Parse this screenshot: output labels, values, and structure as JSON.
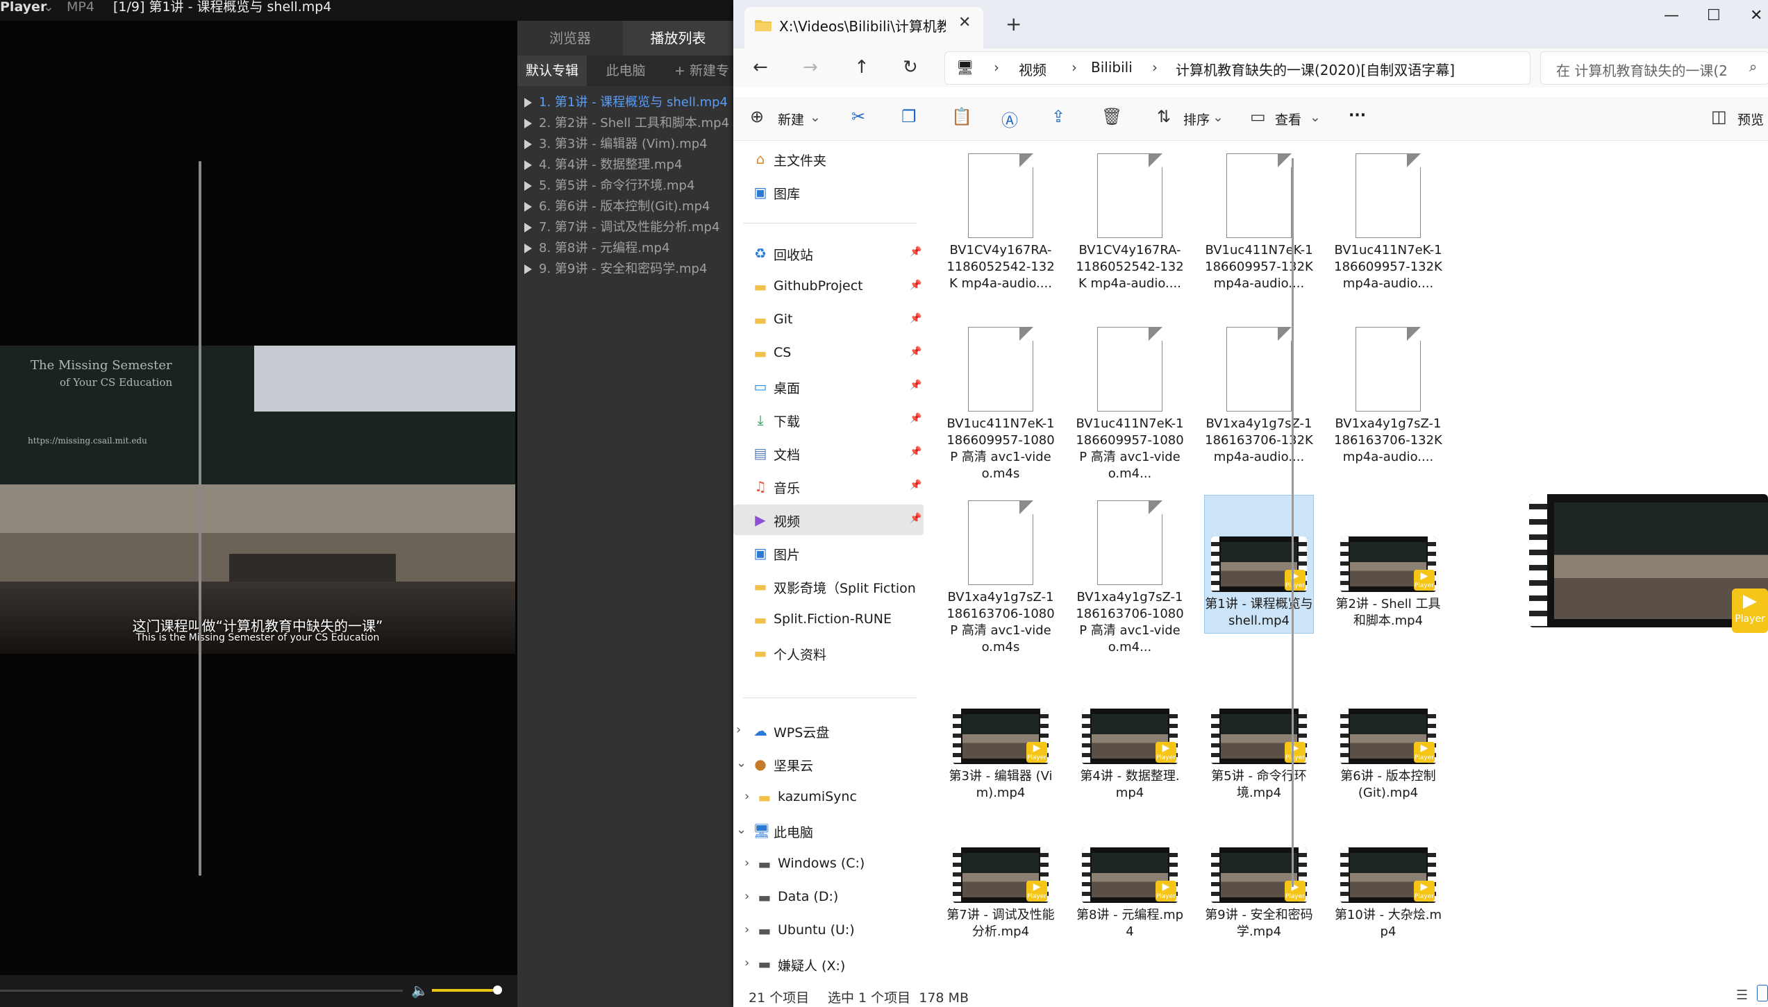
{
  "player": {
    "app_name": "Player",
    "format": "MP4",
    "title": "[1/9] 第1讲 - 课程概览与 shell.mp4",
    "tabs": [
      "浏览器",
      "播放列表"
    ],
    "subtabs": [
      "默认专辑",
      "此电脑",
      "+ 新建专"
    ],
    "playlist": [
      "1. 第1讲 - 课程概览与 shell.mp4",
      "2. 第2讲 - Shell 工具和脚本.mp4",
      "3. 第3讲 - 编辑器 (Vim).mp4",
      "4. 第4讲 - 数据整理.mp4",
      "5. 第5讲 - 命令行环境.mp4",
      "6. 第6讲 - 版本控制(Git).mp4",
      "7. 第7讲 - 调试及性能分析.mp4",
      "8. 第8讲 - 元编程.mp4",
      "9. 第9讲 - 安全和密码学.mp4"
    ],
    "active_index": 0,
    "video": {
      "board_text": "The Missing Semester",
      "board_text2": "of Your CS Education",
      "board_url": "https://missing.csail.mit.edu",
      "subtitle_cn": "这门课程叫做“计算机教育中缺失的一课”",
      "subtitle_en": "This is the Missing Semester of your CS Education"
    },
    "volume_fraction": 0.92,
    "accent": "#5b9cf5"
  },
  "explorer": {
    "tab_title": "X:\\Videos\\Bilibili\\计算机教育缺",
    "window_buttons": [
      "—",
      "☐",
      "✕"
    ],
    "breadcrumb": [
      "视频",
      "Bilibili",
      "计算机教育缺失的一课(2020)[自制双语字幕]"
    ],
    "search_placeholder": "在 计算机教育缺失的一课(2",
    "commands": {
      "new": "新建",
      "sort": "排序",
      "view": "查看",
      "more": "···",
      "preview": "预览"
    },
    "sidebar": [
      {
        "label": "主文件夹",
        "icon": "home-icon"
      },
      {
        "label": "图库",
        "icon": "gallery-icon"
      },
      {
        "label": "回收站",
        "icon": "recycle-bin-icon",
        "pinned": true
      },
      {
        "label": "GithubProject",
        "icon": "folder-icon",
        "pinned": true
      },
      {
        "label": "Git",
        "icon": "folder-icon",
        "pinned": true
      },
      {
        "label": "CS",
        "icon": "folder-icon",
        "pinned": true
      },
      {
        "label": "桌面",
        "icon": "desktop-icon",
        "pinned": true
      },
      {
        "label": "下载",
        "icon": "download-icon",
        "pinned": true
      },
      {
        "label": "文档",
        "icon": "documents-icon",
        "pinned": true
      },
      {
        "label": "音乐",
        "icon": "music-icon",
        "pinned": true
      },
      {
        "label": "视频",
        "icon": "videos-icon",
        "pinned": true,
        "selected": true
      },
      {
        "label": "图片",
        "icon": "pictures-icon"
      },
      {
        "label": "双影奇境（Split Fiction",
        "icon": "folder-icon"
      },
      {
        "label": "Split.Fiction-RUNE",
        "icon": "folder-icon"
      },
      {
        "label": "个人资料",
        "icon": "folder-icon"
      },
      {
        "label": "WPS云盘",
        "icon": "cloud-icon"
      },
      {
        "label": "坚果云",
        "icon": "nut-cloud-icon"
      },
      {
        "label": "kazumiSync",
        "icon": "folder-icon"
      },
      {
        "label": "此电脑",
        "icon": "computer-icon"
      },
      {
        "label": "Windows (C:)",
        "icon": "drive-icon"
      },
      {
        "label": "Data (D:)",
        "icon": "drive-icon"
      },
      {
        "label": "Ubuntu (U:)",
        "icon": "drive-icon"
      },
      {
        "label": "嫌疑人 (X:)",
        "icon": "drive-icon"
      }
    ],
    "files": [
      {
        "name": "BV1CV4y167RA-1186052542-132K mp4a-audio....",
        "kind": "doc"
      },
      {
        "name": "BV1CV4y167RA-1186052542-132K mp4a-audio....",
        "kind": "doc"
      },
      {
        "name": "BV1uc411N7eK-1186609957-132K mp4a-audio....",
        "kind": "doc"
      },
      {
        "name": "BV1uc411N7eK-1186609957-132K mp4a-audio....",
        "kind": "doc"
      },
      {
        "name": "BV1uc411N7eK-1186609957-1080P 高清 avc1-video.m4s",
        "kind": "doc"
      },
      {
        "name": "BV1uc411N7eK-1186609957-1080P 高清 avc1-video.m4...",
        "kind": "doc"
      },
      {
        "name": "BV1xa4y1g7sZ-1186163706-132K mp4a-audio....",
        "kind": "doc"
      },
      {
        "name": "BV1xa4y1g7sZ-1186163706-132K mp4a-audio....",
        "kind": "doc"
      },
      {
        "name": "BV1xa4y1g7sZ-1186163706-1080P 高清 avc1-video.m4s",
        "kind": "doc"
      },
      {
        "name": "BV1xa4y1g7sZ-1186163706-1080P 高清 avc1-video.m4...",
        "kind": "doc"
      },
      {
        "name": "第1讲 - 课程概览与 shell.mp4",
        "kind": "video",
        "selected": true
      },
      {
        "name": "第2讲 - Shell 工具和脚本.mp4",
        "kind": "video"
      },
      {
        "name": "第3讲 - 编辑器 (Vim).mp4",
        "kind": "video"
      },
      {
        "name": "第4讲 - 数据整理.mp4",
        "kind": "video"
      },
      {
        "name": "第5讲 - 命令行环境.mp4",
        "kind": "video"
      },
      {
        "name": "第6讲 - 版本控制 (Git).mp4",
        "kind": "video"
      },
      {
        "name": "第7讲 - 调试及性能分析.mp4",
        "kind": "video"
      },
      {
        "name": "第8讲 - 元编程.mp4",
        "kind": "video"
      },
      {
        "name": "第9讲 - 安全和密码学.mp4",
        "kind": "video"
      },
      {
        "name": "第10讲 - 大杂烩.mp4",
        "kind": "video"
      }
    ],
    "player_badge": "Player",
    "status": {
      "count": "21 个项目",
      "selection": "选中 1 个项目  178 MB"
    },
    "selection_color": "#cce4f7"
  }
}
